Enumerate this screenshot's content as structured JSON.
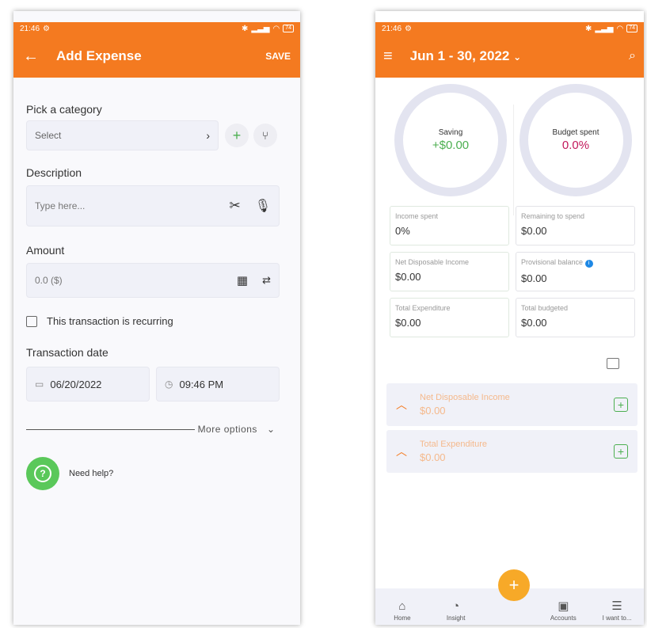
{
  "left": {
    "status": {
      "time": "21:46",
      "battery": "74"
    },
    "appbar": {
      "back": "←",
      "title": "Add Expense",
      "save": "SAVE"
    },
    "category": {
      "label": "Pick a category",
      "value": "Select"
    },
    "description": {
      "label": "Description",
      "placeholder": "Type here..."
    },
    "amount": {
      "label": "Amount",
      "placeholder": "0.0 ($)"
    },
    "recurring": {
      "label": "This transaction is recurring"
    },
    "date": {
      "label": "Transaction date",
      "date": "06/20/2022",
      "time": "09:46 PM"
    },
    "more_options": "More options",
    "help": "Need help?"
  },
  "right": {
    "status": {
      "time": "21:46",
      "battery": "74"
    },
    "appbar": {
      "title": "Jun 1 - 30, 2022"
    },
    "rings": [
      {
        "title": "Saving",
        "value": "+$0.00",
        "color": "#4caf50"
      },
      {
        "title": "Budget spent",
        "value": "0.0%",
        "color": "#c2185b"
      }
    ],
    "cards": [
      {
        "title": "Income spent",
        "value": "0%"
      },
      {
        "title": "Remaining to spend",
        "value": "$0.00"
      },
      {
        "title": "Net Disposable Income",
        "value": "$0.00"
      },
      {
        "title": "Provisional balance",
        "value": "$0.00"
      },
      {
        "title": "Total Expenditure",
        "value": "$0.00"
      },
      {
        "title": "Total budgeted",
        "value": "$0.00"
      }
    ],
    "sections": [
      {
        "title": "Net Disposable Income",
        "value": "$0.00"
      },
      {
        "title": "Total Expenditure",
        "value": "$0.00"
      }
    ],
    "nav": [
      {
        "label": "Home"
      },
      {
        "label": "Insight"
      },
      {
        "label": "Accounts"
      },
      {
        "label": "I want to..."
      }
    ],
    "colors": {
      "accent": "#f47a20",
      "fab": "#f7a928"
    }
  }
}
